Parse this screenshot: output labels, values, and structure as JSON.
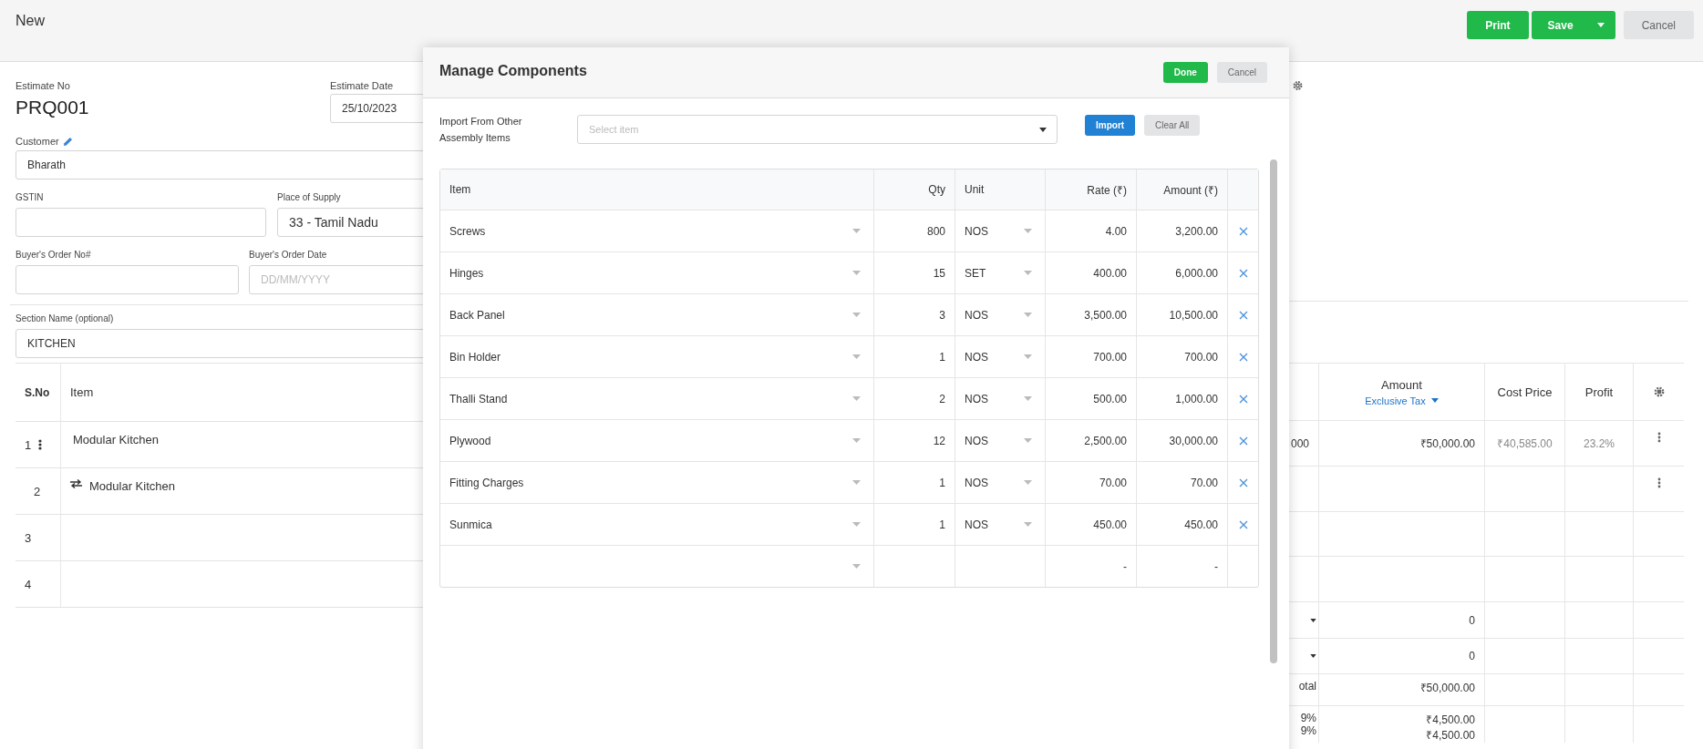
{
  "page": {
    "title": "New",
    "buttons": [
      {
        "label": "Print",
        "kind": "primary"
      },
      {
        "label": "Save",
        "kind": "split"
      },
      {
        "label": "Cancel",
        "kind": "secondary"
      }
    ]
  },
  "form": {
    "estimate_no": {
      "label": "Estimate No",
      "value": "PRQ001"
    },
    "estimate_date": {
      "label": "Estimate Date",
      "value": "25/10/2023"
    },
    "customer": {
      "label": "Customer",
      "value": "Bharath"
    },
    "gstin": {
      "label": "GSTIN"
    },
    "place_of_supply": {
      "label": "Place of Supply",
      "value": "33 - Tamil Nadu"
    },
    "buyers_order_no": {
      "label": "Buyer's Order No#"
    },
    "buyers_order_date": {
      "label": "Buyer's Order Date",
      "placeholder": "DD/MM/YYYY"
    },
    "section_name": {
      "label": "Section Name (optional)",
      "value": "KITCHEN"
    }
  },
  "items_table": {
    "left_columns": [
      "S.No",
      "Item"
    ],
    "right_columns": [
      {
        "label": "Amount",
        "sub": "Exclusive Tax"
      },
      {
        "label": "Cost Price"
      },
      {
        "label": "Profit"
      }
    ],
    "rows": [
      {
        "sno": "1",
        "kind": "menu",
        "item": "Modular Kitchen",
        "column_1": "000",
        "amount": "₹50,000.00",
        "cost_price": "₹40,585.00",
        "profit": "23.2%",
        "menu": true
      },
      {
        "sno": "2",
        "kind": "linked",
        "item": "Modular Kitchen",
        "menu": true
      },
      {
        "sno": "3",
        "kind": "plain",
        "menu": false
      },
      {
        "sno": "4",
        "kind": "plain",
        "menu": false
      }
    ],
    "summary": [
      {
        "dropdown": true,
        "lines": [
          {
            "amount": "0"
          }
        ]
      },
      {
        "dropdown": true,
        "lines": [
          {
            "amount": "0"
          }
        ]
      },
      {
        "dropdown": false,
        "lines": [
          {
            "label": "otal",
            "amount": "₹50,000.00"
          }
        ]
      },
      {
        "dropdown": false,
        "lines": [
          {
            "label": "9%",
            "amount": "₹4,500.00"
          },
          {
            "label": "9%",
            "amount": "₹4,500.00"
          }
        ]
      }
    ]
  },
  "modal": {
    "title": "Manage Components",
    "buttons": [
      {
        "label": "Done",
        "kind": "primary"
      },
      {
        "label": "Cancel",
        "kind": "secondary"
      }
    ],
    "import": {
      "label": "Import From Other Assembly Items",
      "placeholder": "Select item",
      "buttons": [
        {
          "label": "Import",
          "kind": "blue"
        },
        {
          "label": "Clear All",
          "kind": "secondary"
        }
      ]
    },
    "columns": [
      "Item",
      "Qty",
      "Unit",
      "Rate (₹)",
      "Amount (₹)"
    ],
    "rows": [
      {
        "item": "Screws",
        "qty": "800",
        "unit": "NOS",
        "rate": "4.00",
        "amount": "3,200.00",
        "removable": true
      },
      {
        "item": "Hinges",
        "qty": "15",
        "unit": "SET",
        "rate": "400.00",
        "amount": "6,000.00",
        "removable": true
      },
      {
        "item": "Back Panel",
        "qty": "3",
        "unit": "NOS",
        "rate": "3,500.00",
        "amount": "10,500.00",
        "removable": true
      },
      {
        "item": "Bin Holder",
        "qty": "1",
        "unit": "NOS",
        "rate": "700.00",
        "amount": "700.00",
        "removable": true
      },
      {
        "item": "Thalli Stand",
        "qty": "2",
        "unit": "NOS",
        "rate": "500.00",
        "amount": "1,000.00",
        "removable": true
      },
      {
        "item": "Plywood",
        "qty": "12",
        "unit": "NOS",
        "rate": "2,500.00",
        "amount": "30,000.00",
        "removable": true
      },
      {
        "item": "Fitting Charges",
        "qty": "1",
        "unit": "NOS",
        "rate": "70.00",
        "amount": "70.00",
        "removable": true
      },
      {
        "item": "Sunmica",
        "qty": "1",
        "unit": "NOS",
        "rate": "450.00",
        "amount": "450.00",
        "removable": true
      },
      {
        "rate": "-",
        "amount": "-",
        "removable": false
      }
    ]
  }
}
